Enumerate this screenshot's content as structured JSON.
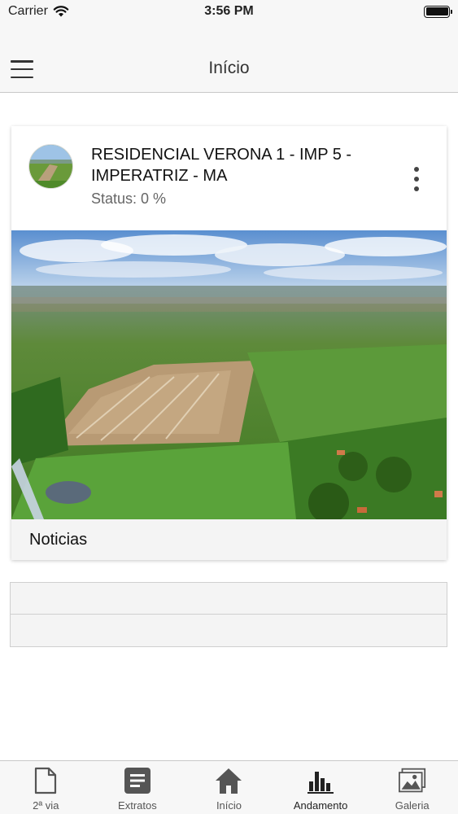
{
  "status_bar": {
    "carrier": "Carrier",
    "time": "3:56 PM"
  },
  "nav": {
    "title": "Início"
  },
  "project_card": {
    "title": "RESIDENCIAL VERONA 1 - IMP 5 - IMPERATRIZ - MA",
    "status": "Status: 0 %",
    "footer_label": "Noticias"
  },
  "tabbar": {
    "items": [
      {
        "label": "2ª via",
        "icon": "document-icon"
      },
      {
        "label": "Extratos",
        "icon": "list-doc-icon"
      },
      {
        "label": "Início",
        "icon": "home-icon"
      },
      {
        "label": "Andamento",
        "icon": "bar-chart-icon"
      },
      {
        "label": "Galeria",
        "icon": "gallery-icon"
      }
    ],
    "active_index": 3
  },
  "colors": {
    "bar_background": "#f7f7f7",
    "icon_color": "#555555",
    "active_icon_color": "#222222"
  }
}
